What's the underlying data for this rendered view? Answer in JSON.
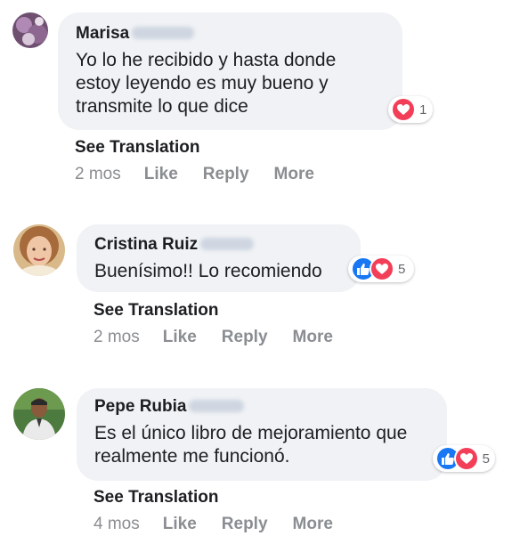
{
  "comments": [
    {
      "author": "Marisa",
      "text": "Yo lo he recibido y hasta donde estoy leyendo es muy bueno y transmite lo que dice",
      "reaction_icons": [
        "heart-reaction"
      ],
      "reaction_count": "1",
      "see_translation": "See Translation",
      "time": "2 mos",
      "like": "Like",
      "reply": "Reply",
      "more": "More"
    },
    {
      "author": "Cristina Ruiz",
      "text": "Buenísimo!! Lo recomiendo",
      "reaction_icons": [
        "like-reaction",
        "heart-reaction"
      ],
      "reaction_count": "5",
      "see_translation": "See Translation",
      "time": "2 mos",
      "like": "Like",
      "reply": "Reply",
      "more": "More"
    },
    {
      "author": "Pepe Rubia",
      "text": "Es el único libro de mejoramiento que realmente me funcionó.",
      "reaction_icons": [
        "like-reaction",
        "heart-reaction"
      ],
      "reaction_count": "5",
      "see_translation": "See Translation",
      "time": "4 mos",
      "like": "Like",
      "reply": "Reply",
      "more": "More"
    }
  ],
  "colors": {
    "bubble": "#f0f2f5",
    "like_blue": "#1877f2",
    "love_red": "#f33e58",
    "muted_text": "#8a8d91"
  }
}
